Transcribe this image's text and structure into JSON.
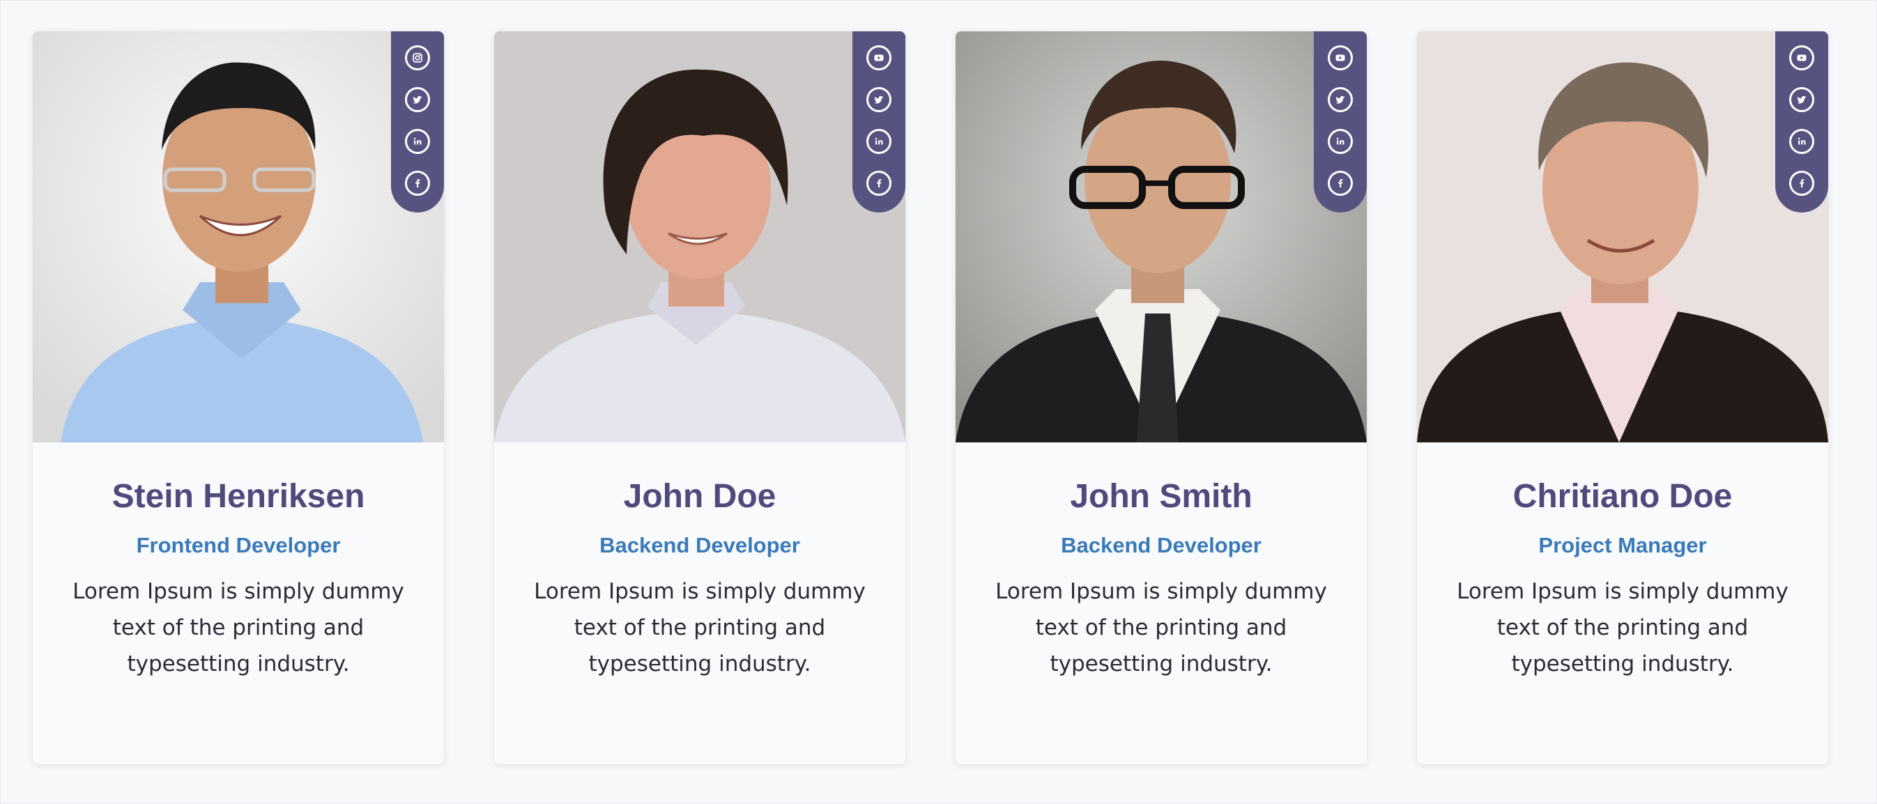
{
  "team": [
    {
      "name": "Stein Henriksen",
      "role": "Frontend Developer",
      "description": "Lorem Ipsum is simply dummy text of the printing and typesetting industry.",
      "photo": "portrait-smiling-man-glasses-blue-shirt",
      "social": [
        "instagram-icon",
        "twitter-icon",
        "linkedin-icon",
        "facebook-icon"
      ]
    },
    {
      "name": "John Doe",
      "role": "Backend Developer",
      "description": "Lorem Ipsum is simply dummy text of the printing and typesetting industry.",
      "photo": "portrait-young-man-dark-hair-white-shirt",
      "social": [
        "youtube-icon",
        "twitter-icon",
        "linkedin-icon",
        "facebook-icon"
      ]
    },
    {
      "name": "John Smith",
      "role": "Backend Developer",
      "description": "Lorem Ipsum is simply dummy text of the printing and typesetting industry.",
      "photo": "portrait-man-black-glasses-suit",
      "social": [
        "youtube-icon",
        "twitter-icon",
        "linkedin-icon",
        "facebook-icon"
      ]
    },
    {
      "name": "Chritiano Doe",
      "role": "Project Manager",
      "description": "Lorem Ipsum is simply dummy text of the printing and typesetting industry.",
      "photo": "portrait-mature-man-dark-blazer",
      "social": [
        "youtube-icon",
        "twitter-icon",
        "linkedin-icon",
        "facebook-icon"
      ]
    }
  ],
  "colors": {
    "accent": "#575380",
    "name": "#4f4a7c",
    "role": "#3a7ab8",
    "text": "#2b2b33",
    "card_bg": "#f9fafc"
  }
}
